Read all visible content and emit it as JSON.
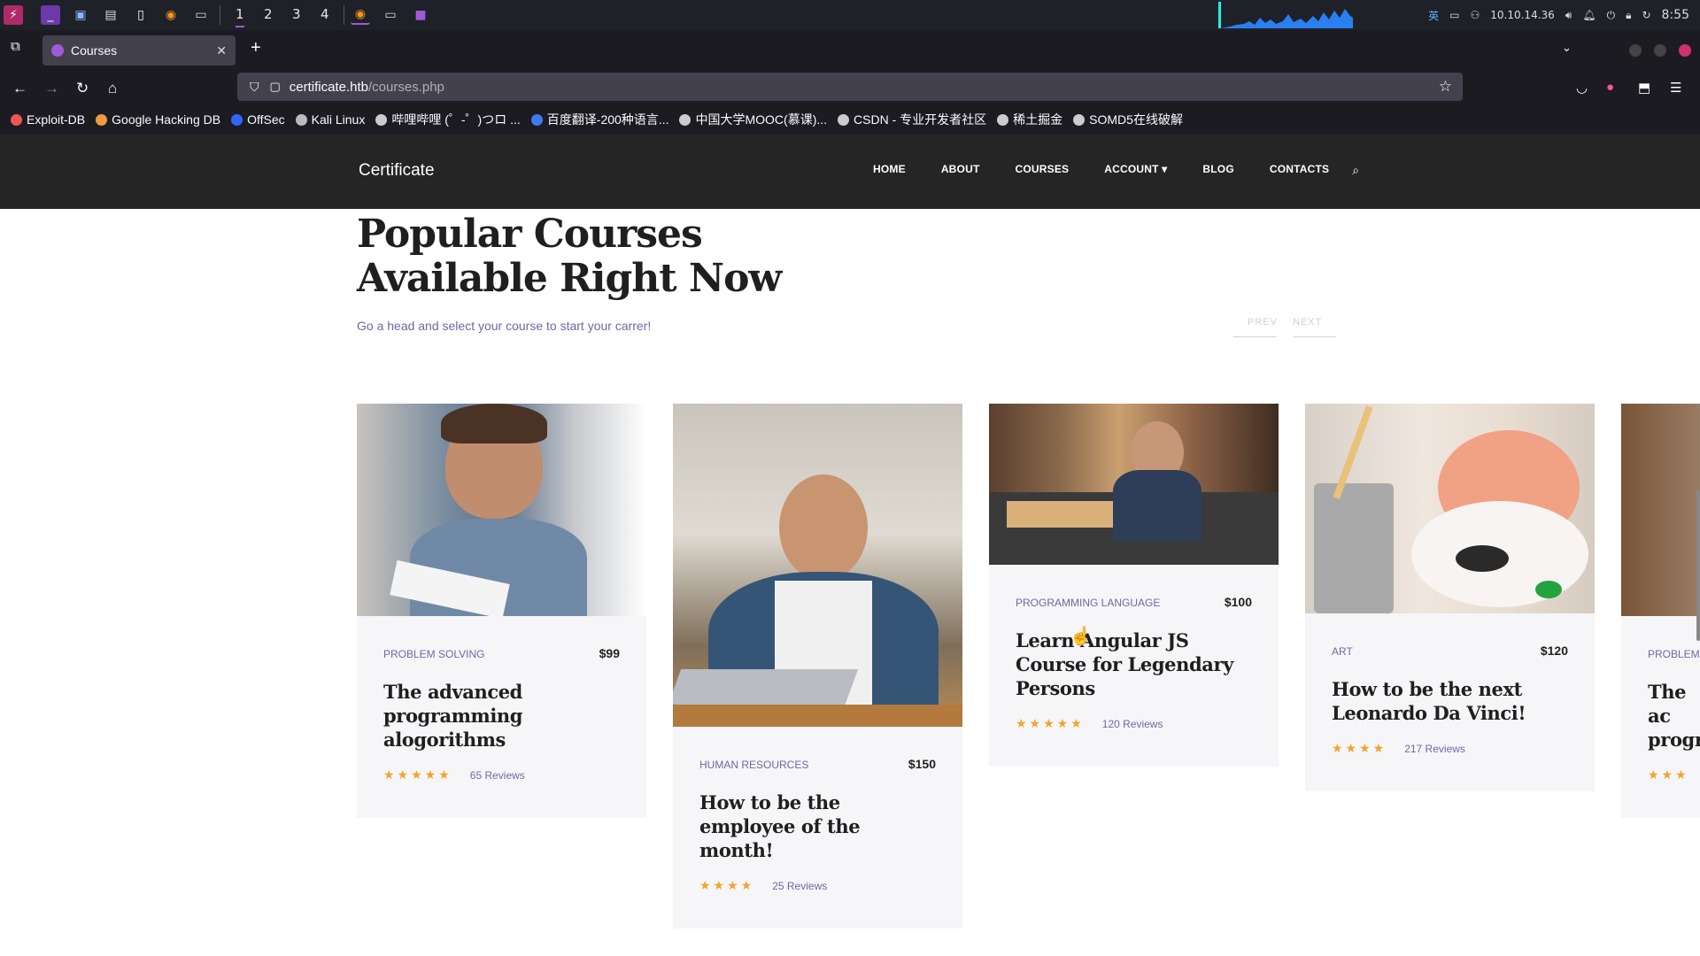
{
  "taskbar": {
    "workspaces": [
      "1",
      "2",
      "3",
      "4"
    ],
    "ip": "10.10.14.36",
    "ime": "英",
    "clock": "8:55"
  },
  "browser": {
    "tab_title": "Courses",
    "url_domain": "certificate.htb",
    "url_path": "/courses.php",
    "bookmarks": [
      {
        "label": "Exploit-DB",
        "icon": "exploit-db-icon",
        "color": "#e55"
      },
      {
        "label": "Google Hacking DB",
        "icon": "ghdb-icon",
        "color": "#e94"
      },
      {
        "label": "OffSec",
        "icon": "offsec-icon",
        "color": "#36f"
      },
      {
        "label": "Kali Linux",
        "icon": "kali-icon",
        "color": "#bbb"
      },
      {
        "label": "哔哩哔哩 (゜-゜)つロ ...",
        "icon": "globe-icon",
        "color": "#ccc"
      },
      {
        "label": "百度翻译-200种语言...",
        "icon": "baidu-translate-icon",
        "color": "#3b7cf0"
      },
      {
        "label": "中国大学MOOC(慕课)...",
        "icon": "globe-icon",
        "color": "#ccc"
      },
      {
        "label": "CSDN - 专业开发者社区",
        "icon": "globe-icon",
        "color": "#ccc"
      },
      {
        "label": "稀土掘金",
        "icon": "globe-icon",
        "color": "#ccc"
      },
      {
        "label": "SOMD5在线破解",
        "icon": "globe-icon",
        "color": "#ccc"
      }
    ]
  },
  "site": {
    "brand": "Certificate",
    "menu": [
      "HOME",
      "ABOUT",
      "COURSES",
      "ACCOUNT ▾",
      "BLOG",
      "CONTACTS"
    ]
  },
  "hero": {
    "title_line1": "Popular Courses",
    "title_line2": "Available Right Now",
    "subtitle": "Go a head and select your course to start your carrer!",
    "prev": "PREV",
    "next": "NEXT"
  },
  "courses": [
    {
      "category": "PROBLEM SOLVING",
      "price": "$99",
      "title": "The advanced programming alogorithms",
      "stars": "★★★★★",
      "reviews": "65 Reviews"
    },
    {
      "category": "HUMAN RESOURCES",
      "price": "$150",
      "title": "How to be the employee of the month!",
      "stars": "★★★★",
      "reviews": "25 Reviews"
    },
    {
      "category": "PROGRAMMING LANGUAGE",
      "price": "$100",
      "title": "Learn Angular JS Course for Legendary Persons",
      "stars": "★★★★★",
      "reviews": "120 Reviews"
    },
    {
      "category": "ART",
      "price": "$120",
      "title": "How to be the next Leonardo Da Vinci!",
      "stars": "★★★★",
      "reviews": "217 Reviews"
    },
    {
      "category": "PROBLEM S",
      "price": "",
      "title": "The ac progr",
      "stars": "★★★",
      "reviews": ""
    }
  ],
  "colors": {
    "accent": "#6a6aa8",
    "star": "#f3a32c",
    "nav_bg": "#252525"
  }
}
